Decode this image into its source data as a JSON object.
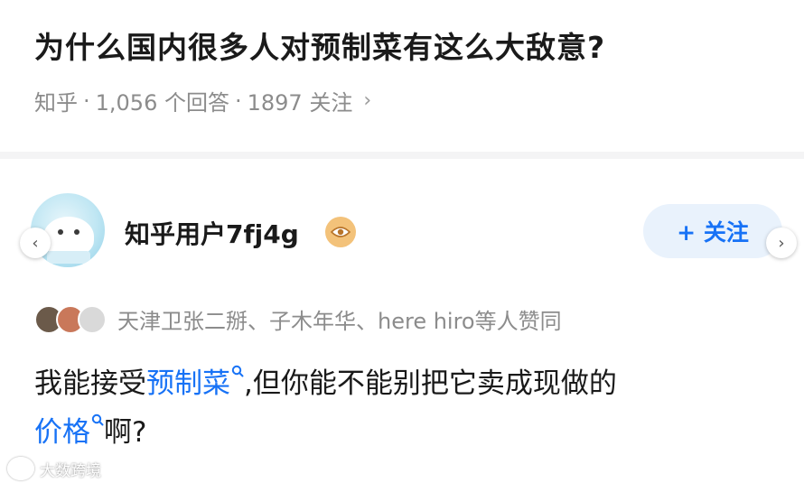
{
  "question": {
    "title": "为什么国内很多人对预制菜有这么大敌意?",
    "source": "知乎",
    "answers_count": "1,056 个回答",
    "followers_count": "1897 关注",
    "chevron": "›"
  },
  "answer": {
    "author": "知乎用户7fj4g",
    "author_badge_icon": "eye-badge-icon",
    "follow_label": "+ 关注",
    "voters_text": "天津卫张二掰、子木年华、here hiro等人赞同",
    "body_part1": "我能接受",
    "keyword1": "预制菜",
    "body_part2": ",但你能不能别把它卖成现做的",
    "keyword2": "价格",
    "body_part3": "啊?"
  },
  "nav": {
    "prev_arrow": "‹",
    "next_arrow": "›"
  },
  "watermark": {
    "text": "大数跨境"
  },
  "colors": {
    "accent": "#1772f6",
    "follow_bg": "#e9f2fc",
    "muted": "#8c8c8c",
    "badge": "#f3c27a"
  }
}
